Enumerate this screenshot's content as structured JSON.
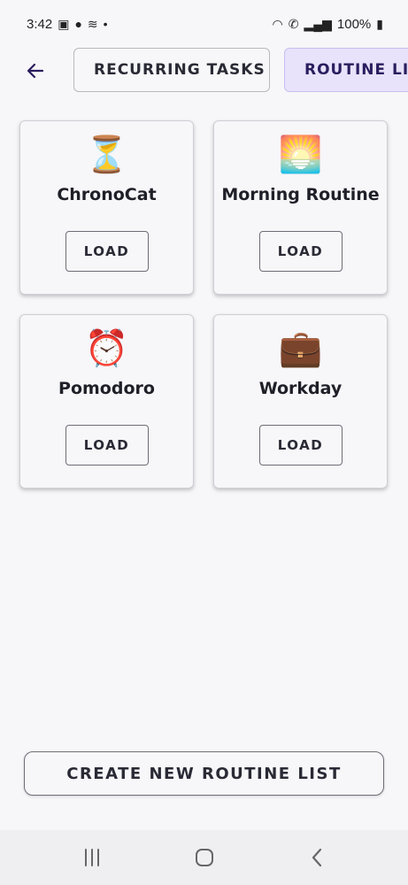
{
  "status_bar": {
    "time": "3:42",
    "battery": "100%"
  },
  "top_bar": {
    "recurring_label": "RECURRING TASKS",
    "routine_label": "ROUTINE LISTS"
  },
  "routines": [
    {
      "emoji": "⏳",
      "icon": "hourglass-icon",
      "title": "ChronoCat",
      "load_label": "LOAD"
    },
    {
      "emoji": "🌅",
      "icon": "sunrise-icon",
      "title": "Morning Routine",
      "load_label": "LOAD"
    },
    {
      "emoji": "⏰",
      "icon": "alarm-clock-icon",
      "title": "Pomodoro",
      "load_label": "LOAD"
    },
    {
      "emoji": "💼",
      "icon": "briefcase-icon",
      "title": "Workday",
      "load_label": "LOAD"
    }
  ],
  "create_label": "CREATE NEW ROUTINE LIST",
  "colors": {
    "accent": "#2a1d5e",
    "selected_chip_bg": "#e8e2fb",
    "background": "#f7f6f9"
  }
}
